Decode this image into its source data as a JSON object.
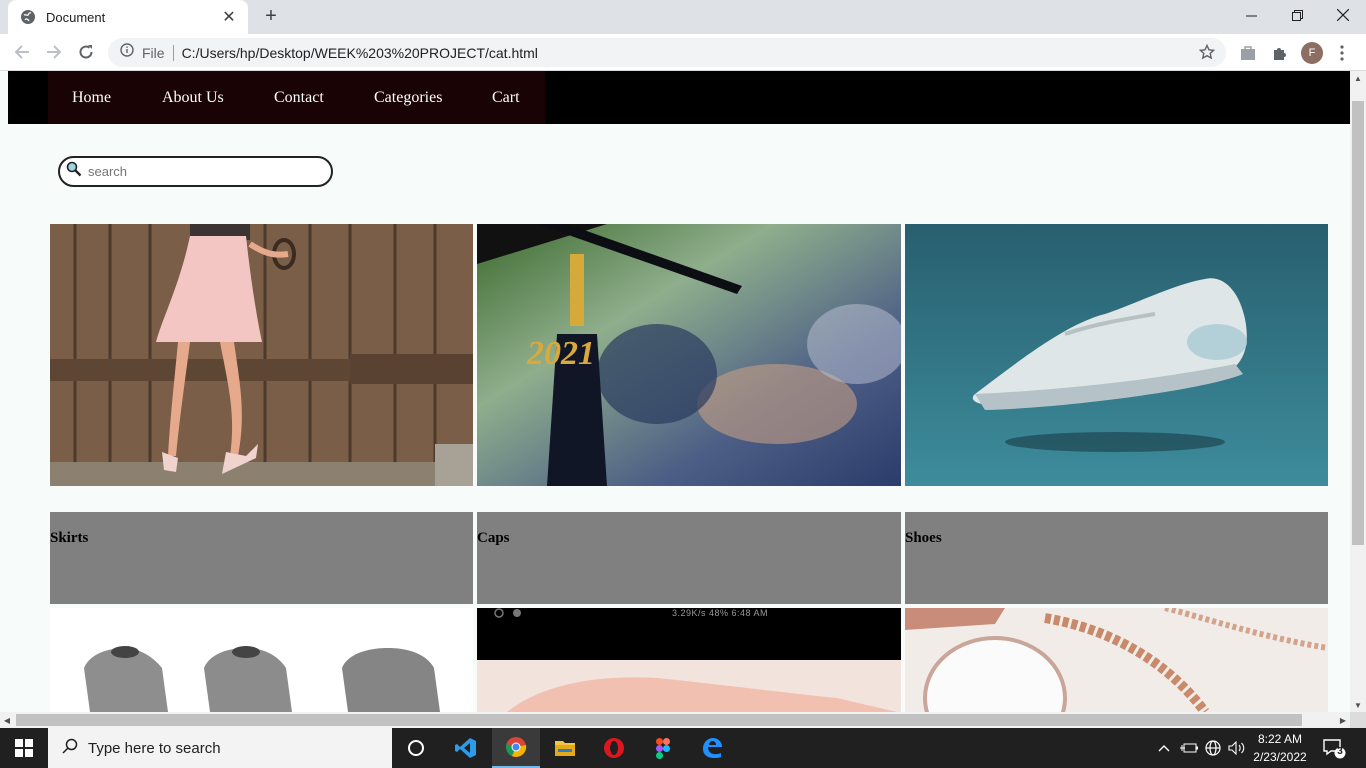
{
  "browser": {
    "tab_title": "Document",
    "omnibox_scheme": "File",
    "url": "C:/Users/hp/Desktop/WEEK%203%20PROJECT/cat.html",
    "profile_initial": "F"
  },
  "site": {
    "nav": [
      "Home",
      "About Us",
      "Contact",
      "Categories",
      "Cart"
    ],
    "search_placeholder": "search",
    "categories": [
      {
        "label": "Skirts",
        "image": "skirt-photo"
      },
      {
        "label": "Caps",
        "image": "graduation-cap-tassel-photo"
      },
      {
        "label": "Shoes",
        "image": "sneaker-photo"
      }
    ],
    "second_row_images": [
      "sweaters-photo",
      "phone-screenshot-photo",
      "jewelry-photo"
    ],
    "second_row_status_text": "3.29K/s  48%  6:48 AM"
  },
  "taskbar": {
    "search_placeholder": "Type here to search",
    "time": "8:22 AM",
    "date": "2/23/2022",
    "notification_count": "3",
    "apps": [
      "cortana-icon",
      "vscode-icon",
      "chrome-icon",
      "file-explorer-icon",
      "opera-icon",
      "figma-icon",
      "edge-icon"
    ]
  },
  "colors": {
    "nav_bg": "#000000",
    "nav_inner_bg": "#1a0304",
    "caption_bg": "#808080",
    "page_bg": "#f7fcfb"
  }
}
